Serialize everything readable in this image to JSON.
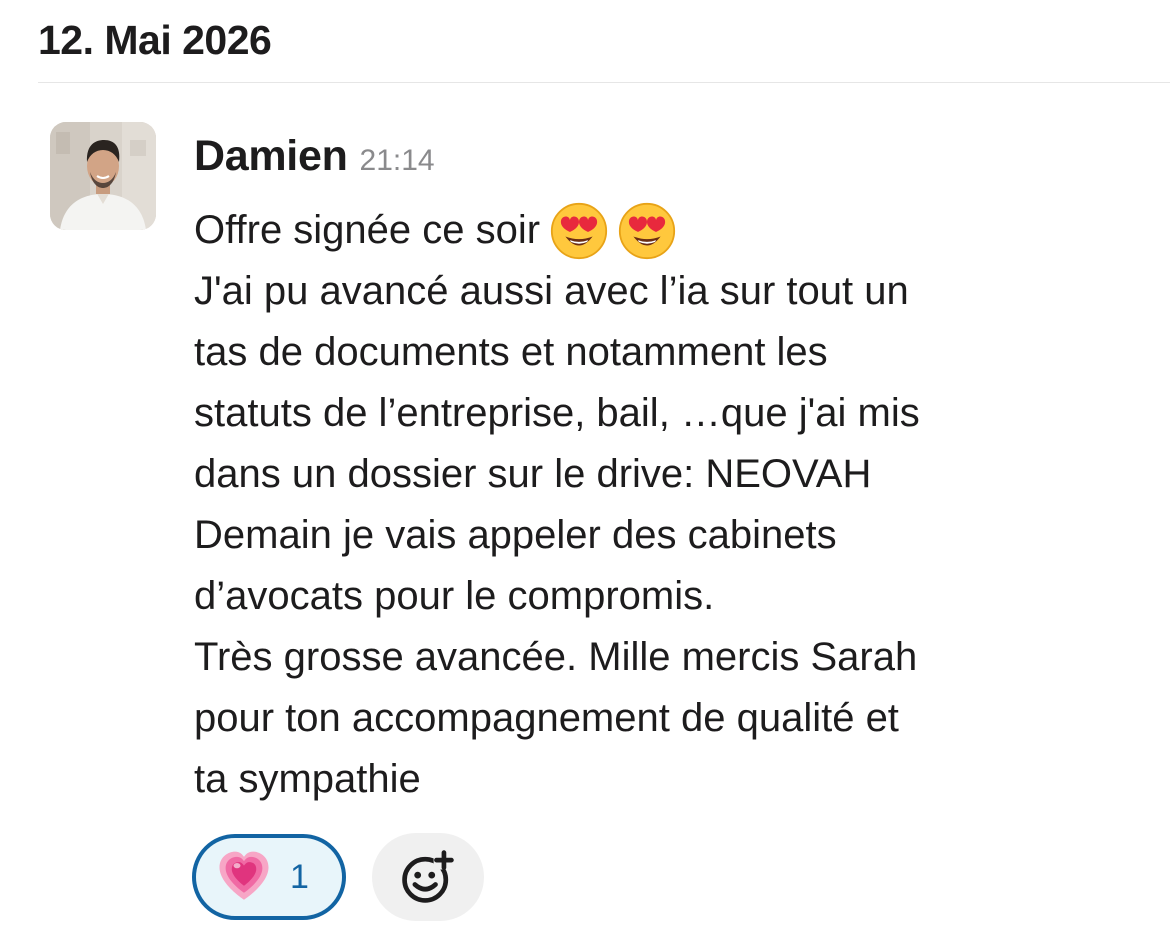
{
  "date_header": "12. Mai 2026",
  "message": {
    "sender": "Damien",
    "timestamp": "21:14",
    "avatar_icon": "user-avatar-photo",
    "lines": [
      "Offre signée ce soir",
      "J'ai pu avancé aussi avec l’ia sur tout un",
      "tas de documents et notamment les",
      "statuts de l’entreprise, bail, …que j'ai mis",
      "dans un dossier sur le drive: NEOVAH",
      "Demain je vais appeler des cabinets",
      "d’avocats pour le compromis.",
      "Très grosse avancée. Mille mercis Sarah",
      "pour ton accompagnement de qualité et",
      "ta sympathie"
    ],
    "inline_emojis": [
      "heart-eyes-emoji",
      "heart-eyes-emoji"
    ]
  },
  "reactions": [
    {
      "emoji": "growing-heart-emoji",
      "count": "1",
      "selected": true
    }
  ],
  "add_reaction_icon": "add-reaction-icon",
  "colors": {
    "text": "#1d1c1d",
    "muted": "#8a8a8c",
    "accent": "#1264a3",
    "reaction_bg": "#e8f5fa"
  }
}
